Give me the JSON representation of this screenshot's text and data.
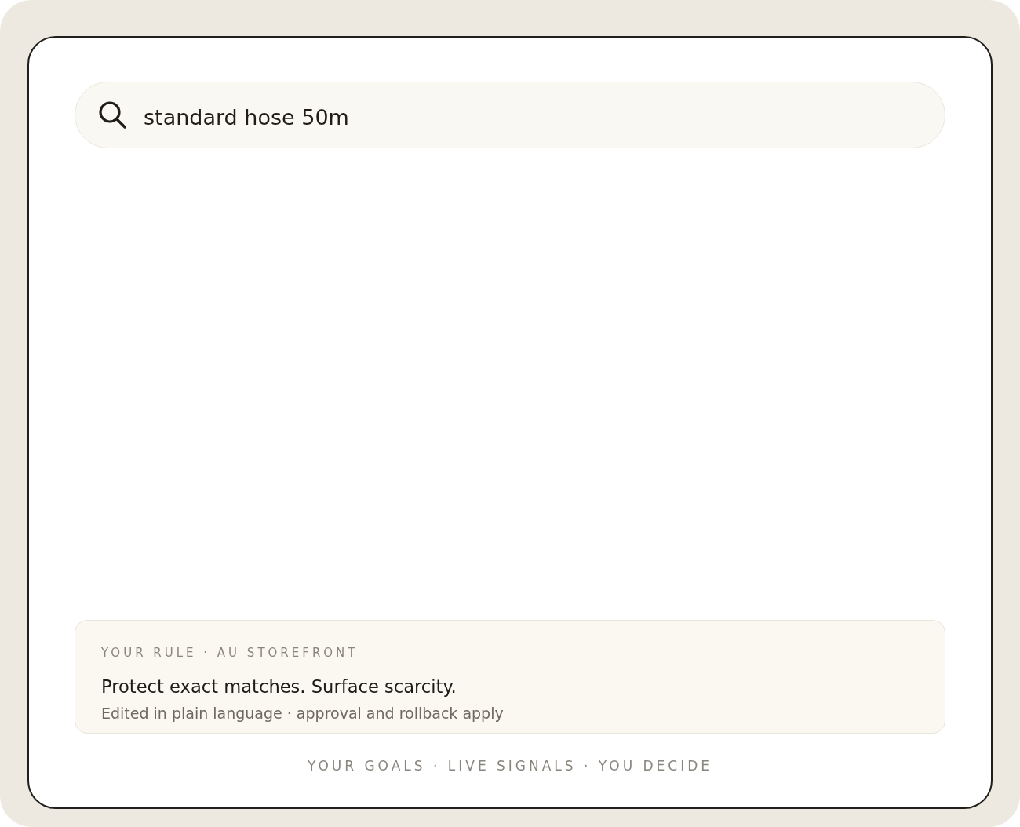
{
  "search": {
    "value": "standard hose 50m"
  },
  "rule_card": {
    "label": "YOUR RULE · AU STOREFRONT",
    "title": "Protect exact matches. Surface scarcity.",
    "note": "Edited in plain language · approval and rollback apply"
  },
  "footer": {
    "tagline": "YOUR GOALS · LIVE SIGNALS · YOU DECIDE"
  }
}
